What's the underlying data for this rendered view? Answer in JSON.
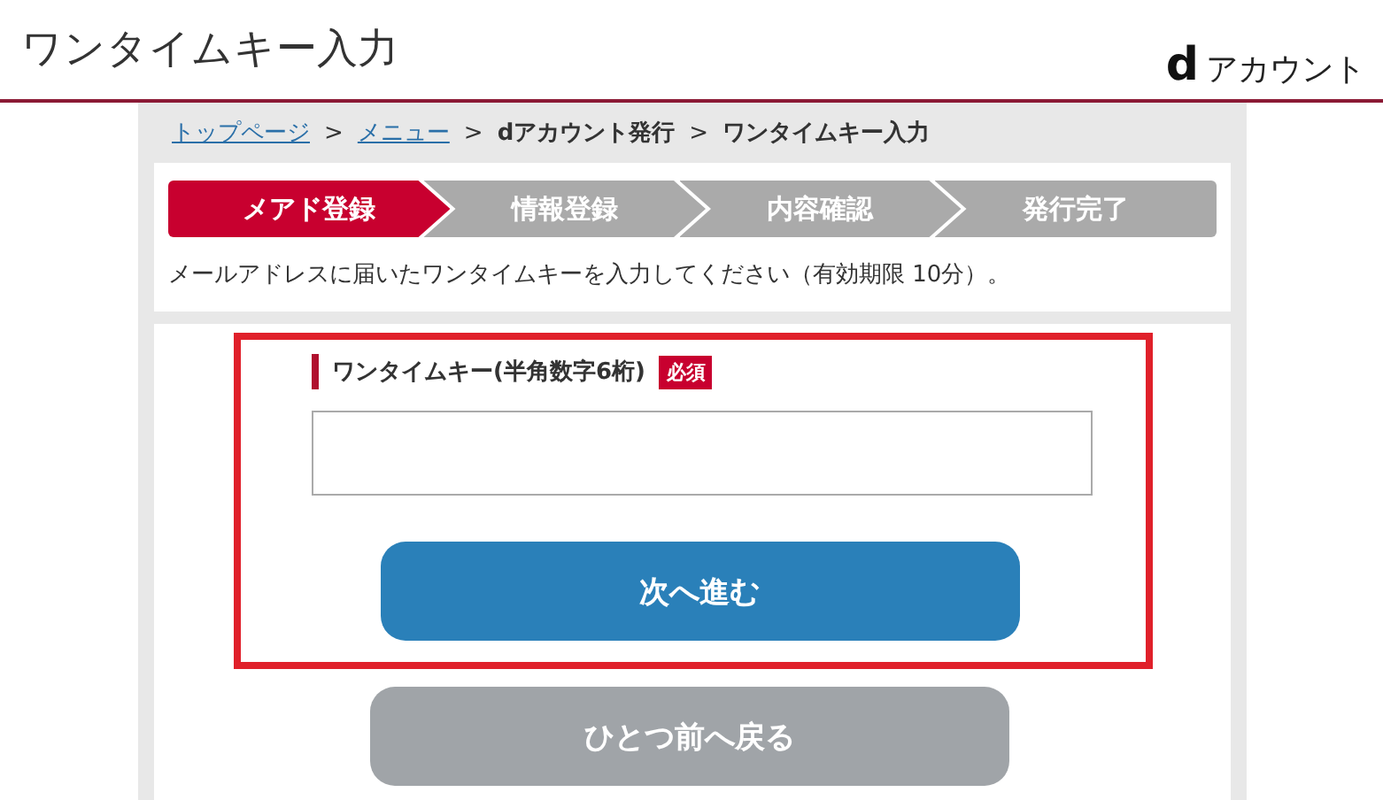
{
  "header": {
    "title": "ワンタイムキー入力",
    "logo_mark": "d",
    "logo_text": "アカウント"
  },
  "breadcrumb": [
    {
      "label": "トップページ",
      "kind": "link"
    },
    {
      "label": "メニュー",
      "kind": "link"
    },
    {
      "label": "dアカウント発行",
      "kind": "text"
    },
    {
      "label": "ワンタイムキー入力",
      "kind": "text"
    }
  ],
  "breadcrumb_separator": ">",
  "steps": [
    {
      "label": "メアド登録",
      "selected": true
    },
    {
      "label": "情報登録",
      "selected": false
    },
    {
      "label": "内容確認",
      "selected": false
    },
    {
      "label": "発行完了",
      "selected": false
    }
  ],
  "message": "メールアドレスに届いたワンタイムキーを入力してください（有効期限 10分）。",
  "form": {
    "label": "ワンタイムキー(半角数字6桁)",
    "required_badge": "必須"
  },
  "buttons": [
    {
      "label": "次へ進む",
      "kind": "primary"
    },
    {
      "label": "ひとつ前へ戻る",
      "kind": "secondary"
    }
  ]
}
